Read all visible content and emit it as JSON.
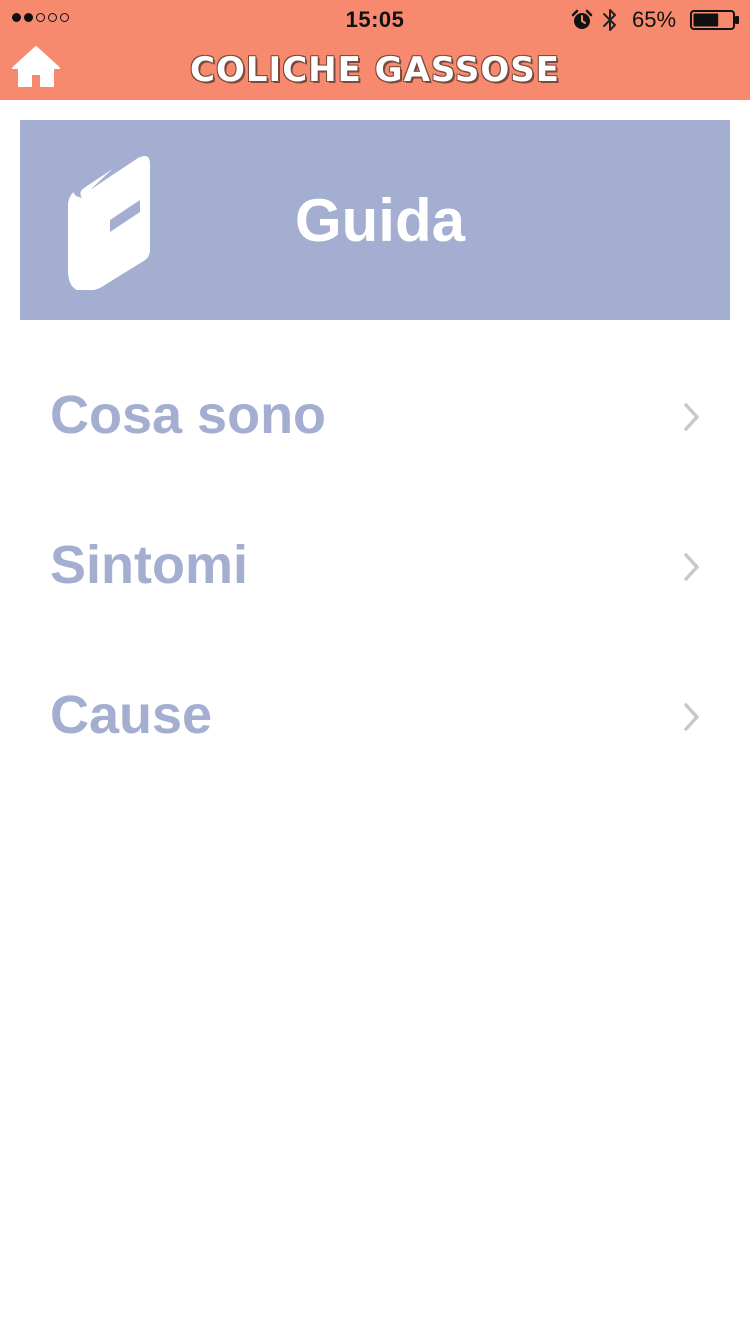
{
  "status_bar": {
    "time": "15:05",
    "battery_percent": "65%",
    "battery_level": 0.65,
    "signal_strength_of_5": 2,
    "icons": [
      "signal-dots-icon",
      "alarm-icon",
      "bluetooth-icon",
      "battery-icon"
    ]
  },
  "nav": {
    "title": "COLICHE GASSOSE",
    "home_icon": "home-icon"
  },
  "banner": {
    "title": "Guida",
    "icon": "book-icon"
  },
  "menu": {
    "items": [
      {
        "label": "Cosa sono",
        "icon": "chevron-right-icon"
      },
      {
        "label": "Sintomi",
        "icon": "chevron-right-icon"
      },
      {
        "label": "Cause",
        "icon": "chevron-right-icon"
      }
    ]
  },
  "colors": {
    "accent": "#f78a6e",
    "primary": "#a3aed1",
    "chevron": "#c7c7cc",
    "background": "#ffffff"
  }
}
